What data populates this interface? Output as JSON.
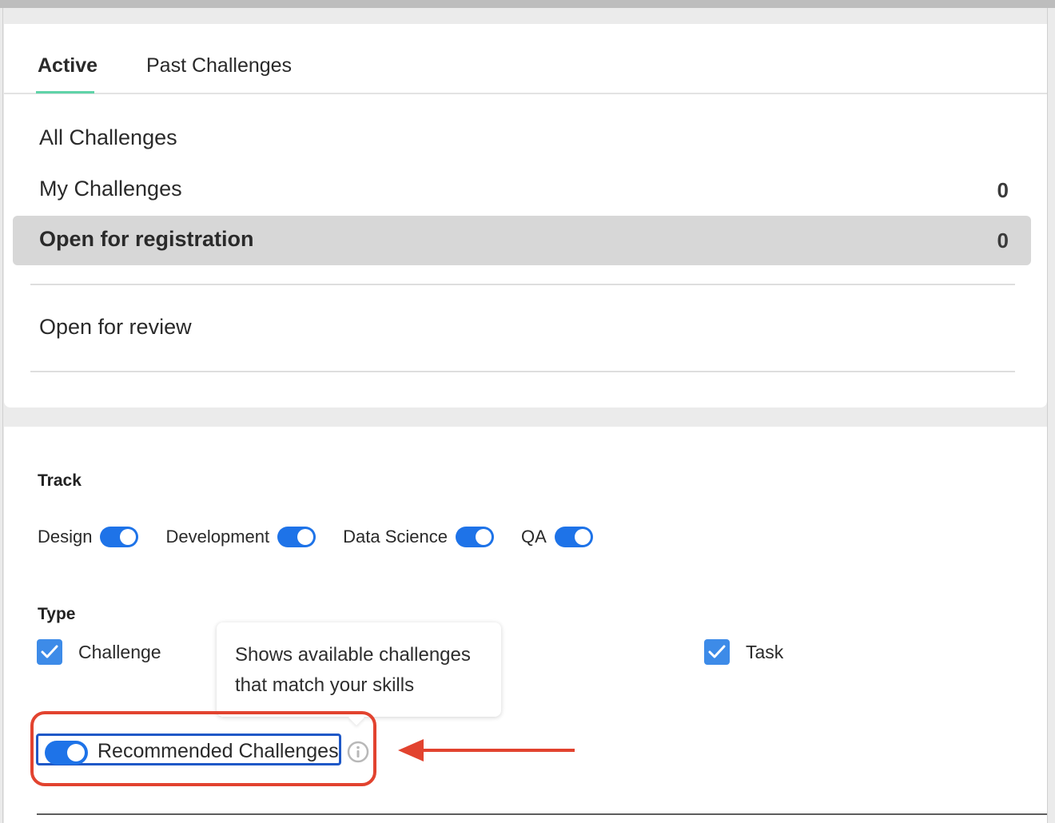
{
  "tabs": {
    "active": "Active",
    "past": "Past Challenges"
  },
  "bucket_list": {
    "all": {
      "label": "All Challenges"
    },
    "my": {
      "label": "My Challenges",
      "count": "0"
    },
    "open_registration": {
      "label": "Open for registration",
      "count": "0"
    },
    "open_review": {
      "label": "Open for review"
    }
  },
  "filters": {
    "track_title": "Track",
    "tracks": [
      "Design",
      "Development",
      "Data Science",
      "QA"
    ],
    "type_title": "Type",
    "types": [
      "Challenge",
      "Task"
    ],
    "recommended_label": "Recommended Challenges",
    "tooltip": "Shows available challenges that match your skills"
  },
  "colors": {
    "toggle_on": "#1e73e8",
    "checkbox": "#3d8be8",
    "annotation": "#e2432f",
    "tab_underline": "#5fd3a8"
  }
}
